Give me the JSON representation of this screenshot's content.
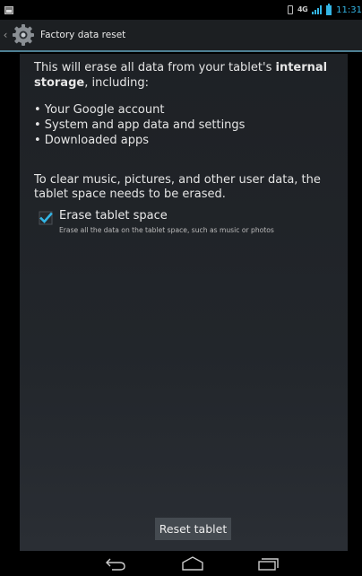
{
  "status_bar": {
    "time": "11:31",
    "network": "4G"
  },
  "action_bar": {
    "title": "Factory data reset",
    "icon": "settings-gear-icon"
  },
  "content": {
    "intro_text": "This will erase all data from your tablet's ",
    "intro_bold": "internal storage",
    "intro_suffix": ", including:",
    "bullets": [
      "• Your Google account",
      "• System and app data and settings",
      "• Downloaded apps"
    ],
    "clear_text": "To clear music, pictures, and other user data, the tablet space needs to be erased.",
    "erase_option": {
      "title": "Erase tablet space",
      "subtitle": "Erase all the data on the tablet space, such as music or photos",
      "checked": true
    }
  },
  "reset_button": {
    "label": "Reset tablet"
  },
  "nav_bar": {
    "back": "back-icon",
    "home": "home-icon",
    "recents": "recents-icon"
  },
  "colors": {
    "accent": "#33b5e5",
    "action_bar_divider": "#4e7f93",
    "button_bg": "#444a50"
  }
}
